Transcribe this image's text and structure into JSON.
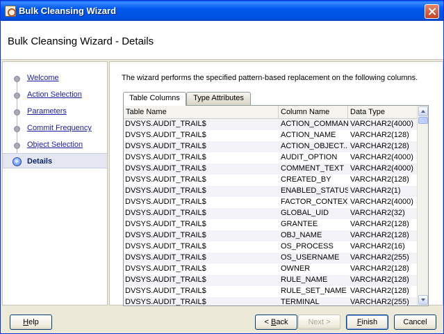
{
  "window": {
    "title": "Bulk Cleansing Wizard"
  },
  "header": {
    "title": "Bulk Cleansing Wizard - Details"
  },
  "nav": {
    "items": [
      {
        "label": "Welcome",
        "active": false
      },
      {
        "label": "Action Selection",
        "active": false
      },
      {
        "label": "Parameters",
        "active": false
      },
      {
        "label": "Commit Frequency",
        "active": false
      },
      {
        "label": "Object Selection",
        "active": false
      },
      {
        "label": "Details",
        "active": true
      }
    ]
  },
  "main": {
    "description": "The wizard performs the specified pattern-based replacement on the following columns.",
    "tabs": [
      {
        "label": "Table Columns",
        "selected": true
      },
      {
        "label": "Type Attributes",
        "selected": false
      }
    ],
    "table": {
      "headers": [
        "Table Name",
        "Column Name",
        "Data Type"
      ],
      "rows": [
        [
          "DVSYS.AUDIT_TRAIL$",
          "ACTION_COMMAND",
          "VARCHAR2(4000)"
        ],
        [
          "DVSYS.AUDIT_TRAIL$",
          "ACTION_NAME",
          "VARCHAR2(128)"
        ],
        [
          "DVSYS.AUDIT_TRAIL$",
          "ACTION_OBJECT...",
          "VARCHAR2(128)"
        ],
        [
          "DVSYS.AUDIT_TRAIL$",
          "AUDIT_OPTION",
          "VARCHAR2(4000)"
        ],
        [
          "DVSYS.AUDIT_TRAIL$",
          "COMMENT_TEXT",
          "VARCHAR2(4000)"
        ],
        [
          "DVSYS.AUDIT_TRAIL$",
          "CREATED_BY",
          "VARCHAR2(128)"
        ],
        [
          "DVSYS.AUDIT_TRAIL$",
          "ENABLED_STATUS",
          "VARCHAR2(1)"
        ],
        [
          "DVSYS.AUDIT_TRAIL$",
          "FACTOR_CONTEXT",
          "VARCHAR2(4000)"
        ],
        [
          "DVSYS.AUDIT_TRAIL$",
          "GLOBAL_UID",
          "VARCHAR2(32)"
        ],
        [
          "DVSYS.AUDIT_TRAIL$",
          "GRANTEE",
          "VARCHAR2(128)"
        ],
        [
          "DVSYS.AUDIT_TRAIL$",
          "OBJ_NAME",
          "VARCHAR2(128)"
        ],
        [
          "DVSYS.AUDIT_TRAIL$",
          "OS_PROCESS",
          "VARCHAR2(16)"
        ],
        [
          "DVSYS.AUDIT_TRAIL$",
          "OS_USERNAME",
          "VARCHAR2(255)"
        ],
        [
          "DVSYS.AUDIT_TRAIL$",
          "OWNER",
          "VARCHAR2(128)"
        ],
        [
          "DVSYS.AUDIT_TRAIL$",
          "RULE_NAME",
          "VARCHAR2(128)"
        ],
        [
          "DVSYS.AUDIT_TRAIL$",
          "RULE_SET_NAME",
          "VARCHAR2(128)"
        ],
        [
          "DVSYS.AUDIT_TRAIL$",
          "TERMINAL",
          "VARCHAR2(255)"
        ]
      ]
    }
  },
  "buttons": {
    "help": {
      "label": "Help",
      "mnemonic": "H"
    },
    "back": {
      "label": "< Back",
      "mnemonic": "B"
    },
    "next": {
      "label": "Next >",
      "disabled": true
    },
    "finish": {
      "label": "Finish",
      "mnemonic": "F"
    },
    "cancel": {
      "label": "Cancel"
    }
  }
}
